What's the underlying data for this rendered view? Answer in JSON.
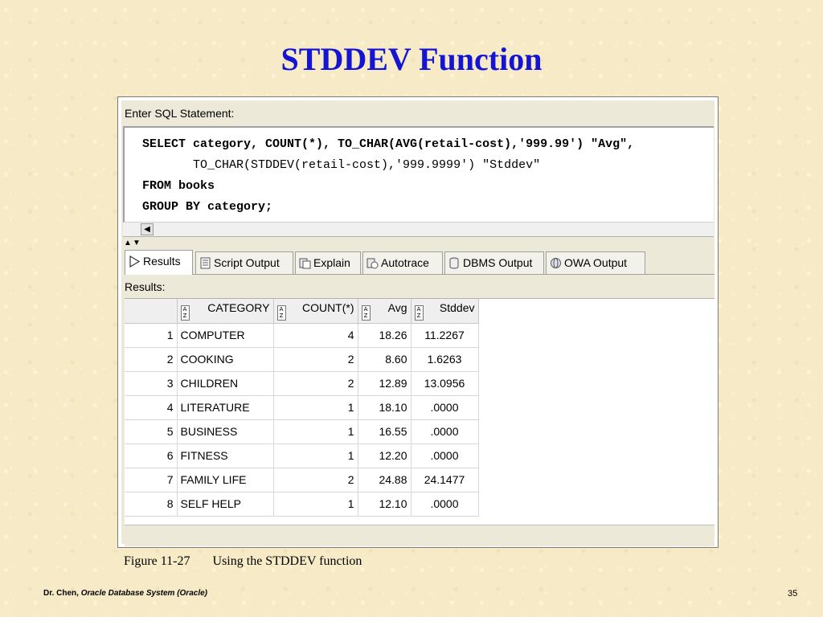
{
  "slide": {
    "title": "STDDEV Function",
    "caption_number": "Figure 11-27",
    "caption_text": "Using the STDDEV function",
    "footer_author": "Dr. Chen,",
    "footer_course": "Oracle Database System (Oracle)",
    "page_number": "35"
  },
  "sql_panel": {
    "label": "Enter SQL Statement:",
    "lines": [
      "SELECT category, COUNT(*), TO_CHAR(AVG(retail-cost),'999.99') \"Avg\",",
      "       TO_CHAR(STDDEV(retail-cost),'999.9999') \"Stddev\"",
      "FROM books",
      "GROUP BY category;"
    ]
  },
  "tabs": [
    {
      "label": "Results",
      "icon": "results-arrow-icon"
    },
    {
      "label": "Script Output",
      "icon": "script-output-icon"
    },
    {
      "label": "Explain",
      "icon": "explain-icon"
    },
    {
      "label": "Autotrace",
      "icon": "autotrace-icon"
    },
    {
      "label": "DBMS Output",
      "icon": "dbms-output-icon"
    },
    {
      "label": "OWA Output",
      "icon": "owa-output-icon"
    }
  ],
  "results": {
    "label": "Results:",
    "columns": [
      "CATEGORY",
      "COUNT(*)",
      "Avg",
      "Stddev"
    ],
    "rows": [
      [
        "1",
        "COMPUTER",
        "4",
        "18.26",
        "11.2267"
      ],
      [
        "2",
        "COOKING",
        "2",
        "8.60",
        "1.6263"
      ],
      [
        "3",
        "CHILDREN",
        "2",
        "12.89",
        "13.0956"
      ],
      [
        "4",
        "LITERATURE",
        "1",
        "18.10",
        ".0000"
      ],
      [
        "5",
        "BUSINESS",
        "1",
        "16.55",
        ".0000"
      ],
      [
        "6",
        "FITNESS",
        "1",
        "12.20",
        ".0000"
      ],
      [
        "7",
        "FAMILY LIFE",
        "2",
        "24.88",
        "24.1477"
      ],
      [
        "8",
        "SELF HELP",
        "1",
        "12.10",
        ".0000"
      ]
    ]
  },
  "colors": {
    "title": "#1414d2",
    "background": "#f6ebc6"
  }
}
